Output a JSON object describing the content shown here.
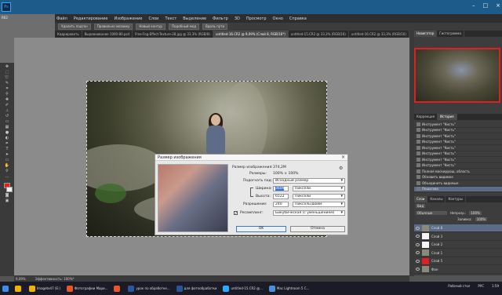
{
  "app": {
    "icon_text": "Ps",
    "menu": [
      "Файл",
      "Редактирование",
      "Изображение",
      "Слои",
      "Текст",
      "Выделение",
      "Фильтр",
      "3D",
      "Просмотр",
      "Окно",
      "Справка"
    ],
    "preview_label": "R62"
  },
  "options_bar": {
    "buttons": [
      "Удалить подгон",
      "Правильно мозаику",
      "Новый контур",
      "Подобный мод",
      "Вдоль пути"
    ]
  },
  "document_tabs": [
    {
      "label": "Кадрировать",
      "active": false
    },
    {
      "label": "Выравнивание 1000-80.psd",
      "active": false
    },
    {
      "label": "Free-Fog-Effect-Texture-28.jpg @ 33,3% (RGB/8)",
      "active": false
    },
    {
      "label": "untitled-16.CR2 @ 9,09% (Слой 8, RGB/16*)",
      "active": true
    },
    {
      "label": "untitled-15.CR2 @ 33,3% (RGB/16)",
      "active": false
    },
    {
      "label": "untitled-16.CR2 @ 33,3% (RGB/16)",
      "active": false
    }
  ],
  "navigator": {
    "tabs": [
      "Навигатор",
      "Гистограмма"
    ]
  },
  "history": {
    "tabs": [
      "Коррекция",
      "История"
    ],
    "items": [
      {
        "label": "Инструмент \"Кисть\"",
        "selected": false
      },
      {
        "label": "Инструмент \"Кисть\"",
        "selected": false
      },
      {
        "label": "Инструмент \"Кисть\"",
        "selected": false
      },
      {
        "label": "Инструмент \"Кисть\"",
        "selected": false
      },
      {
        "label": "Инструмент \"Кисть\"",
        "selected": false
      },
      {
        "label": "Инструмент \"Кисть\"",
        "selected": false
      },
      {
        "label": "Инструмент \"Кисть\"",
        "selected": false
      },
      {
        "label": "Инструмент \"Кисть\"",
        "selected": false
      },
      {
        "label": "Полная маскирующ. область",
        "selected": false
      },
      {
        "label": "Обновить видимое",
        "selected": false
      },
      {
        "label": "Объединить видимые",
        "selected": false
      },
      {
        "label": "Пошагово",
        "selected": true
      }
    ]
  },
  "layers": {
    "tabs": [
      "Слои",
      "Каналы",
      "Контуры"
    ],
    "filter_label": "Вид",
    "mode": "Обычные",
    "opacity_label": "Непрозр.:",
    "opacity_value": "100%",
    "fill_label": "Заливка:",
    "fill_value": "100%",
    "items": [
      {
        "label": "Слой 8",
        "thumb": "photo",
        "selected": true
      },
      {
        "label": "Слой 3",
        "thumb": "white",
        "selected": false
      },
      {
        "label": "Слой 2",
        "thumb": "white",
        "selected": false
      },
      {
        "label": "Слой 1",
        "thumb": "photo",
        "selected": false
      },
      {
        "label": "Слой 5",
        "thumb": "red",
        "selected": false
      },
      {
        "label": "Фон",
        "thumb": "photo",
        "selected": false
      }
    ]
  },
  "status": {
    "zoom": "9,09%",
    "info": "Эффективность: 100%*"
  },
  "dialog": {
    "title": "Размер изображения",
    "image_size_label": "Размер изображения:",
    "image_size_value": "374,2M",
    "dimensions_label": "Размеры:",
    "dimensions_value": "100% × 100%",
    "fit_label": "Подогнать под:",
    "fit_value": "Исходный размер",
    "width_label": "Ширина:",
    "width_value": "3609",
    "width_unit": "Пиксели",
    "height_label": "Высота:",
    "height_value": "6522",
    "height_unit": "Пиксели",
    "resolution_label": "Разрешение:",
    "resolution_value": "240",
    "resolution_unit": "Пиксель/дюйм",
    "resample_label": "Ресамплинг:",
    "resample_checked": true,
    "resample_value": "Бикубическая (с уменьшением)",
    "ok_label": "OK",
    "cancel_label": "Отмена"
  },
  "taskbar": {
    "items": [
      {
        "label": "",
        "color": "#f0b400"
      },
      {
        "label": "Imagete47 (E:)",
        "color": "#f0b400"
      },
      {
        "label": "Фотографии Мари...",
        "color": "#e8562a"
      },
      {
        "label": "",
        "color": "#e8562a"
      },
      {
        "label": "урок по обработке...",
        "color": "#2b579a"
      },
      {
        "label": "для фотообработки",
        "color": "#2b579a"
      },
      {
        "label": "untitled-15.CR2 @...",
        "color": "#31a8ff"
      },
      {
        "label": "Mac Lightroom 5 C...",
        "color": "#4a90d9"
      }
    ],
    "tray_text": "Рабочий стол",
    "lang": "РУС",
    "time": "1:59"
  },
  "colors": {
    "accent": "#31a8ff",
    "selection": "#5c6c87",
    "navigator_frame": "#e02020"
  }
}
